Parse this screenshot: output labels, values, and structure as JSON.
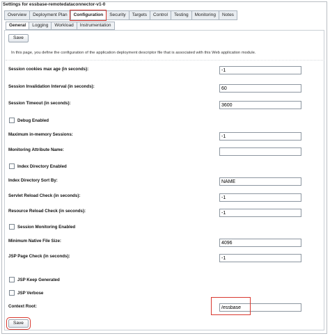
{
  "page_title": "Settings for essbase-remotedataconnector-v1-0",
  "main_tabs": [
    "Overview",
    "Deployment Plan",
    "Configuration",
    "Security",
    "Targets",
    "Control",
    "Testing",
    "Monitoring",
    "Notes"
  ],
  "sub_tabs": [
    "General",
    "Logging",
    "Workload",
    "Instrumentation"
  ],
  "save_label": "Save",
  "intro_text": "In this page, you define the configuration of the application deployment descriptor file that is associated with this Web application module.",
  "fields": {
    "session_cookies_max_age": {
      "label": "Session cookies max age (in seconds):",
      "value": "-1"
    },
    "session_invalidation_interval": {
      "label": "Session Invalidation Interval (in seconds):",
      "value": "60"
    },
    "session_timeout": {
      "label": "Session Timeout (in seconds):",
      "value": "3600"
    },
    "debug_enabled": {
      "label": "Debug Enabled",
      "checked": false
    },
    "max_in_memory_sessions": {
      "label": "Maximum in-memory Sessions:",
      "value": "-1"
    },
    "monitoring_attribute_name": {
      "label": "Monitoring Attribute Name:",
      "value": ""
    },
    "index_directory_enabled": {
      "label": "Index Directory Enabled",
      "checked": false
    },
    "index_directory_sort_by": {
      "label": "Index Directory Sort By:",
      "value": "NAME"
    },
    "servlet_reload_check": {
      "label": "Servlet Reload Check (in seconds):",
      "value": "-1"
    },
    "resource_reload_check": {
      "label": "Resource Reload Check (in seconds):",
      "value": "-1"
    },
    "session_monitoring_enabled": {
      "label": "Session Monitoring Enabled",
      "checked": false
    },
    "min_native_file_size": {
      "label": "Minimum Native File Size:",
      "value": "4096"
    },
    "jsp_page_check": {
      "label": "JSP Page Check (in seconds):",
      "value": "-1"
    },
    "jsp_keep_generated": {
      "label": "JSP Keep Generated",
      "checked": false
    },
    "jsp_verbose": {
      "label": "JSP Verbose",
      "checked": false
    },
    "context_root": {
      "label": "Context Root:",
      "value": "/essbase"
    }
  },
  "highlight_color": "#d9382f"
}
